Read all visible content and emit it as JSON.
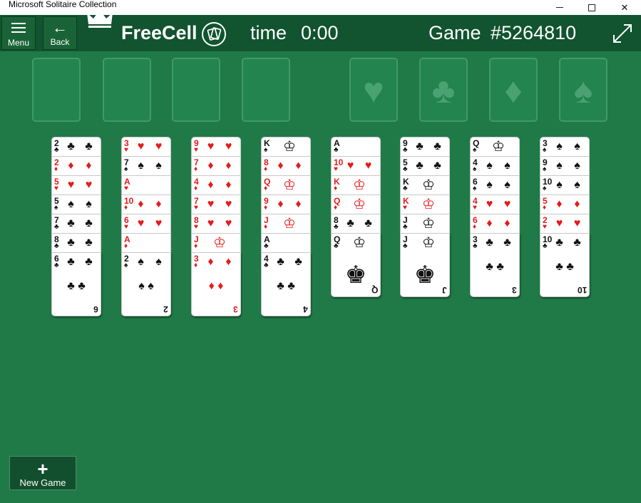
{
  "window": {
    "title": "Microsoft Solitaire Collection"
  },
  "toolbar": {
    "menu_label": "Menu",
    "back_label": "Back",
    "game_name": "FreeCell",
    "time_label": "time",
    "time_value": "0:00",
    "game_label": "Game",
    "game_number": "#5264810"
  },
  "free_cells": [
    "",
    "",
    "",
    ""
  ],
  "foundations": [
    {
      "suit": "♥",
      "name": "hearts"
    },
    {
      "suit": "♣",
      "name": "clubs"
    },
    {
      "suit": "♦",
      "name": "diamonds"
    },
    {
      "suit": "♠",
      "name": "spades"
    }
  ],
  "tableau": [
    [
      "2♣",
      "2♦",
      "5♥",
      "5♠",
      "7♣",
      "8♣",
      "6♣"
    ],
    [
      "3♥",
      "7♠",
      "A♥",
      "10♦",
      "6♥",
      "A♦",
      "2♠"
    ],
    [
      "9♥",
      "7♦",
      "4♦",
      "7♥",
      "8♥",
      "J♦",
      "3♦"
    ],
    [
      "K♠",
      "8♦",
      "Q♦",
      "9♦",
      "J♦",
      "A♣",
      "4♣"
    ],
    [
      "A♣",
      "10♥",
      "K♦",
      "Q♦",
      "8♣",
      "Q♣"
    ],
    [
      "9♣",
      "5♣",
      "K♣",
      "K♥",
      "J♣",
      "J♣"
    ],
    [
      "Q♠",
      "4♠",
      "6♠",
      "4♥",
      "6♦",
      "3♣"
    ],
    [
      "3♠",
      "9♠",
      "10♠",
      "5♦",
      "2♥",
      "10♣"
    ]
  ],
  "new_game": {
    "label": "New Game"
  },
  "colors": {
    "felt": "#1f7a47",
    "appbar": "#11542f",
    "red_suit": "#e41b1b",
    "black_suit": "#111111"
  }
}
